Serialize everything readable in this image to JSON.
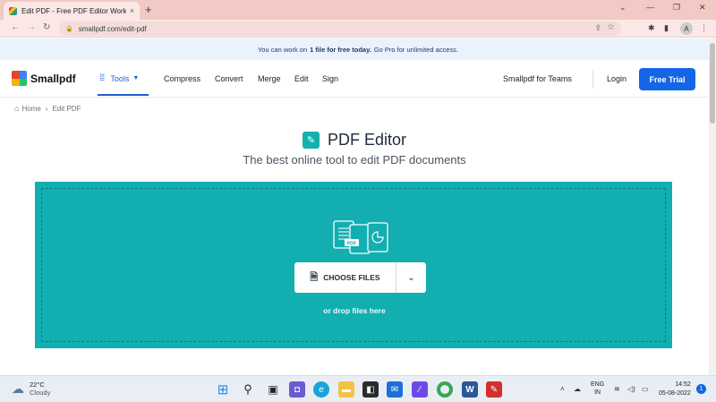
{
  "browser": {
    "tab_title": "Edit PDF - Free PDF Editor Worki",
    "tab_close": "×",
    "new_tab": "+",
    "url": "smallpdf.com/edit-pdf",
    "window": {
      "minimize": "—",
      "restore": "❐",
      "close": "✕",
      "collapse": "⌄"
    },
    "avatar_initial": "A"
  },
  "banner": {
    "prefix": "You can work on",
    "bold": "1 file for free today.",
    "suffix": "Go Pro for unlimited access."
  },
  "header": {
    "logo_text": "Smallpdf",
    "tools_label": "Tools",
    "nav": [
      "Compress",
      "Convert",
      "Merge",
      "Edit",
      "Sign"
    ],
    "teams_label": "Smallpdf for Teams",
    "login_label": "Login",
    "trial_label": "Free Trial"
  },
  "breadcrumb": {
    "home": "Home",
    "current": "Edit PDF"
  },
  "page": {
    "title": "PDF Editor",
    "subtitle": "The best online tool to edit PDF documents"
  },
  "dropzone": {
    "choose_label": "CHOOSE FILES",
    "drop_hint": "or drop files here",
    "pdf_tag": "PDF"
  },
  "taskbar": {
    "temperature": "22°C",
    "condition": "Cloudy",
    "lang_1": "ENG",
    "lang_2": "IN",
    "time": "14:52",
    "date": "05-08-2022",
    "notification_count": "1"
  },
  "colors": {
    "accent_teal": "#13aeb0",
    "primary_blue": "#1566e6",
    "tab_bar": "#f2c9c4"
  }
}
